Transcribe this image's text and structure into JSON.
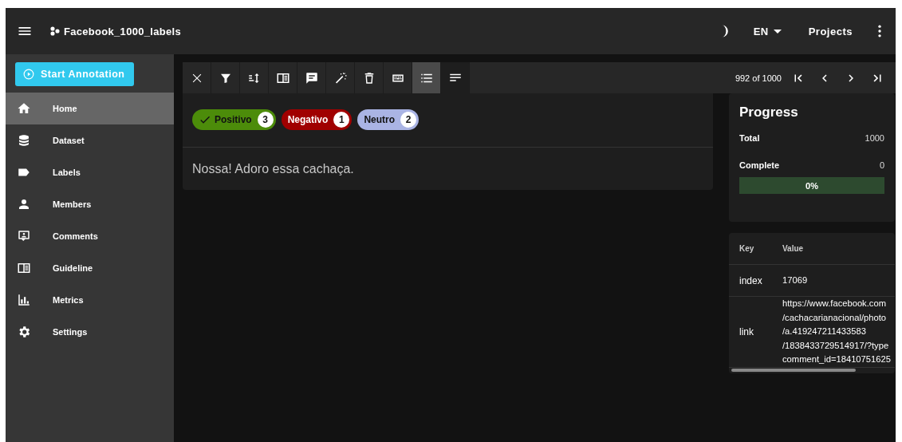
{
  "header": {
    "project_title": "Facebook_1000_labels",
    "language": "EN",
    "projects_link": "Projects"
  },
  "sidebar": {
    "start_button": "Start Annotation",
    "items": [
      {
        "label": "Home",
        "selected": true
      },
      {
        "label": "Dataset",
        "selected": false
      },
      {
        "label": "Labels",
        "selected": false
      },
      {
        "label": "Members",
        "selected": false
      },
      {
        "label": "Comments",
        "selected": false
      },
      {
        "label": "Guideline",
        "selected": false
      },
      {
        "label": "Metrics",
        "selected": false
      },
      {
        "label": "Settings",
        "selected": false
      }
    ]
  },
  "toolbar": {
    "view_modes": [
      {
        "selected": true
      },
      {
        "selected": false
      }
    ],
    "pagination": "992 of 1000"
  },
  "labels": [
    {
      "text": "Positivo",
      "count": "3",
      "color": "#4c8c0a",
      "selected": true
    },
    {
      "text": "Negativo",
      "count": "1",
      "color": "#a00000",
      "selected": false
    },
    {
      "text": "Neutro",
      "count": "2",
      "color": "#aab4e4",
      "selected": false
    }
  ],
  "document_text": "Nossa! Adoro essa cachaça.",
  "progress": {
    "title": "Progress",
    "rows": [
      {
        "label": "Total",
        "value": "1000"
      },
      {
        "label": "Complete",
        "value": "0"
      }
    ],
    "level": 0,
    "percent": "0%"
  },
  "metadata": {
    "columns": [
      "Key",
      "Value"
    ],
    "rows": [
      {
        "key": "index",
        "value": [
          "17069"
        ]
      },
      {
        "key": "link",
        "value": [
          "https://www.facebook.com",
          "/cachacarianacional/photo",
          "/a.419247211433583",
          "/1838433729514917/?type",
          "comment_id=18410751625"
        ]
      }
    ]
  }
}
